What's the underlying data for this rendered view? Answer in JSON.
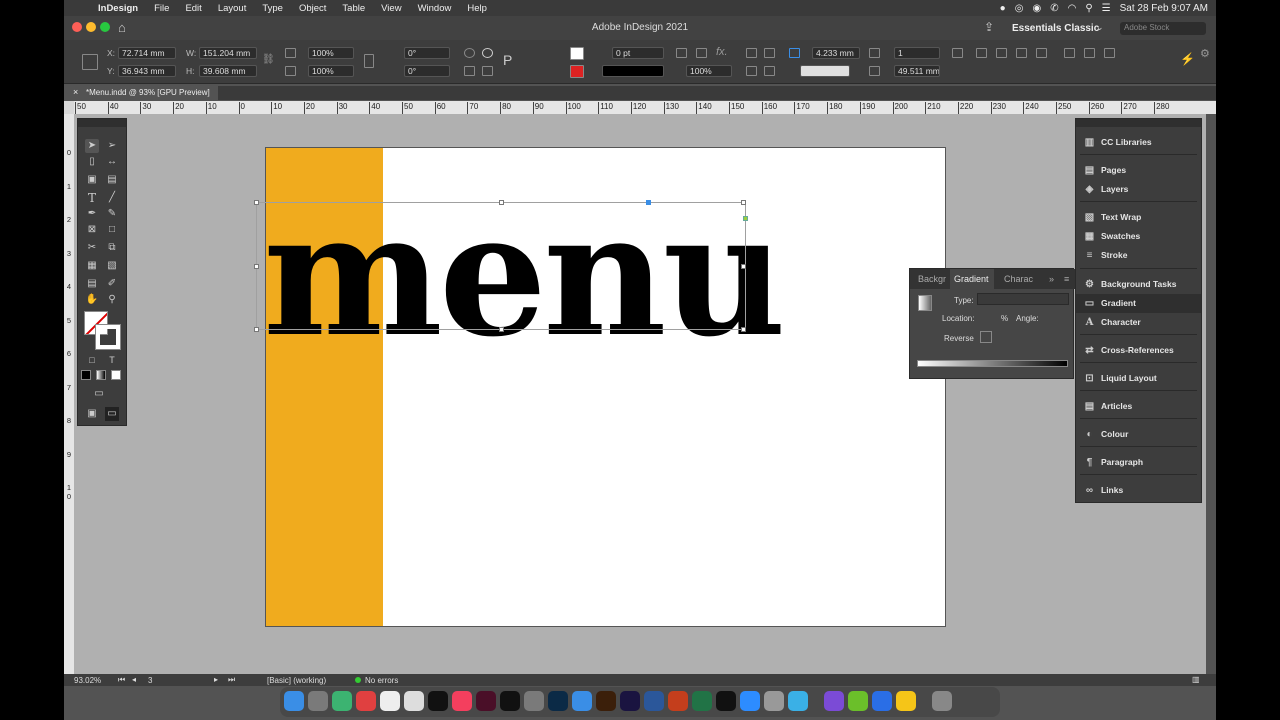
{
  "menubar": {
    "app_name": "InDesign",
    "items": [
      "File",
      "Edit",
      "Layout",
      "Type",
      "Object",
      "Table",
      "View",
      "Window",
      "Help"
    ],
    "clock": "Sat 28 Feb  9:07 AM"
  },
  "titlebar": {
    "title": "Adobe InDesign 2021",
    "workspace": "Essentials Classic",
    "search_placeholder": "Adobe Stock"
  },
  "control": {
    "x_label": "X:",
    "x_value": "72.714 mm",
    "y_label": "Y:",
    "y_value": "36.943 mm",
    "w_label": "W:",
    "w_value": "151.204 mm",
    "h_label": "H:",
    "h_value": "39.608 mm",
    "scale_x": "100%",
    "scale_y": "100%",
    "angle": "0°",
    "shear": "0°",
    "stroke_weight": "0 pt",
    "opacity": "100%",
    "offset_value": "4.233 mm",
    "columns": "1",
    "col_width": "49.511 mm"
  },
  "document_tab": {
    "label": "*Menu.indd @ 93% [GPU Preview]"
  },
  "rulers": {
    "h_labels": [
      "50",
      "40",
      "30",
      "20",
      "10",
      "0",
      "10",
      "20",
      "30",
      "40",
      "50",
      "60",
      "70",
      "80",
      "90",
      "100",
      "110",
      "120",
      "130",
      "140",
      "150",
      "160",
      "170",
      "180",
      "190",
      "200",
      "210",
      "220",
      "230",
      "240",
      "250",
      "260",
      "270",
      "280"
    ],
    "v_labels": [
      "0",
      "1",
      "2",
      "3",
      "4",
      "5",
      "6",
      "7",
      "8",
      "9",
      "1 0"
    ]
  },
  "canvas": {
    "headline": "menu",
    "accent_color": "#f0ab1e"
  },
  "gradient_panel": {
    "tabs": [
      "Backgr",
      "Gradient",
      "Charac"
    ],
    "type_label": "Type:",
    "location_label": "Location:",
    "location_unit": "%",
    "angle_label": "Angle:",
    "reverse_label": "Reverse"
  },
  "right_panel": {
    "items": [
      "CC Libraries",
      "Pages",
      "Layers",
      "Text Wrap",
      "Swatches",
      "Stroke",
      "Background Tasks",
      "Gradient",
      "Character",
      "Cross-References",
      "Liquid Layout",
      "Articles",
      "Colour",
      "Paragraph",
      "Links"
    ],
    "selected": "Gradient"
  },
  "statusbar": {
    "zoom": "93.02%",
    "page": "3",
    "style": "[Basic] (working)",
    "errors": "No errors"
  }
}
